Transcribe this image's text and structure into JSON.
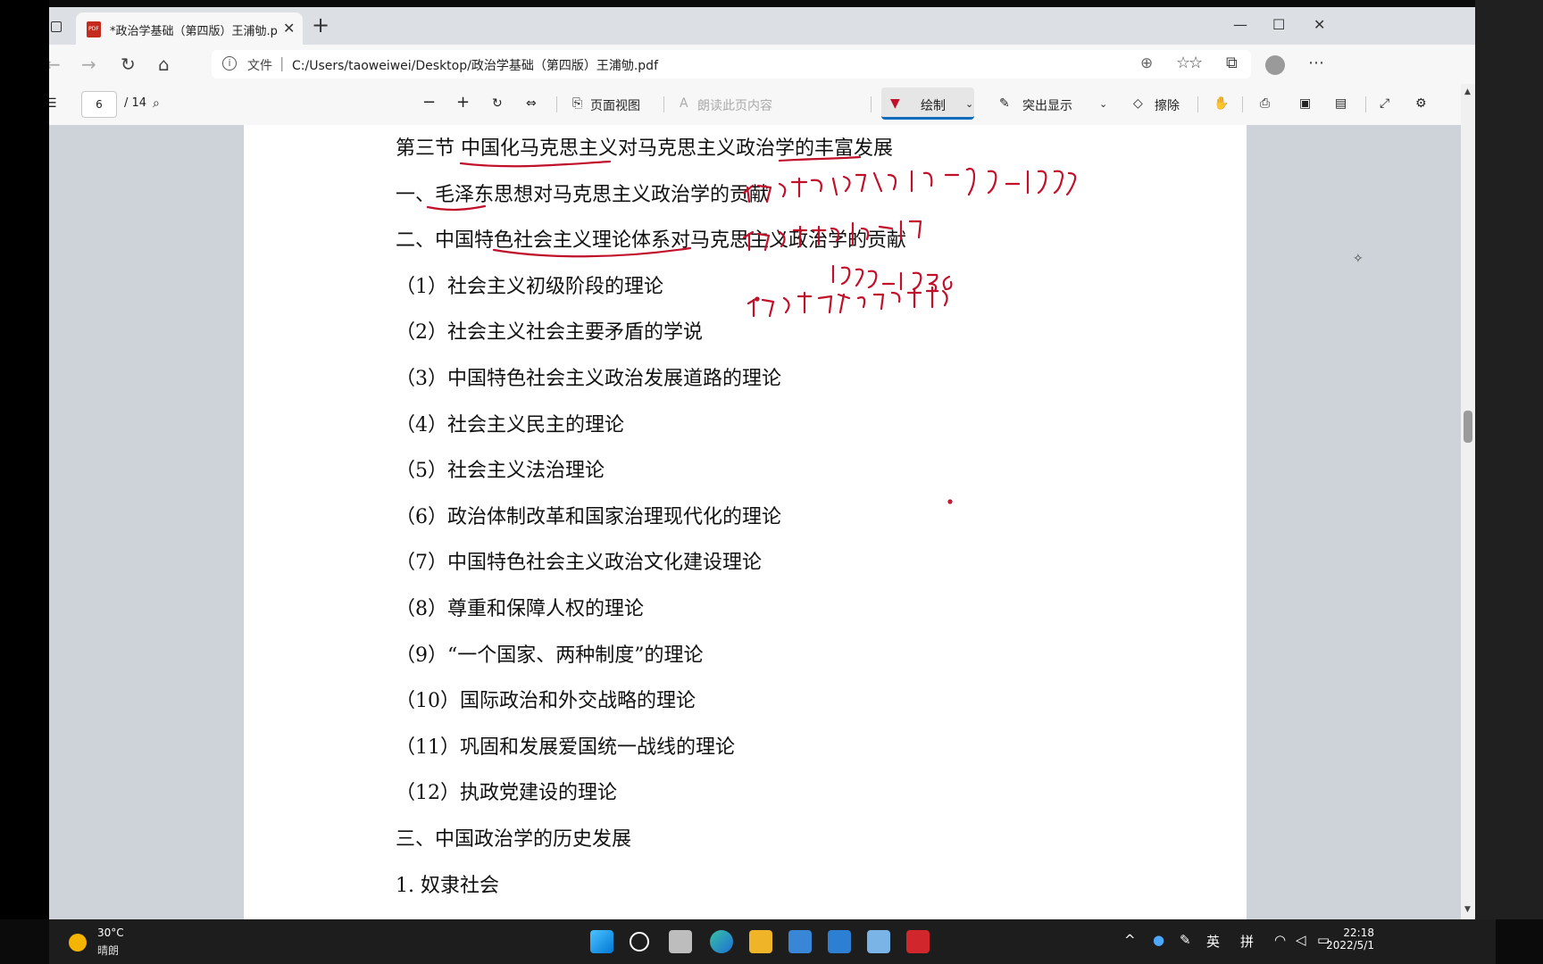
{
  "tab": {
    "title": "*政治学基础（第四版）王浦劬.p",
    "close": "✕",
    "new": "+"
  },
  "window_controls": {
    "minimize": "—",
    "maximize": "☐",
    "close": "✕"
  },
  "address": {
    "scheme": "文件",
    "url": "C:/Users/taoweiwei/Desktop/政治学基础（第四版）王浦劬.pdf"
  },
  "pdf_toolbar": {
    "page_current": "6",
    "page_total": "/ 14",
    "page_view": "页面视图",
    "read_aloud": "朗读此页内容",
    "draw": "绘制",
    "highlight": "突出显示",
    "erase": "擦除"
  },
  "document": {
    "heading": "第三节  中国化马克思主义对马克思主义政治学的丰富发展",
    "lines": [
      "一、毛泽东思想对马克思主义政治学的贡献",
      "二、中国特色社会主义理论体系对马克思主义政治学的贡献",
      "（1）社会主义初级阶段的理论",
      "（2）社会主义社会主要矛盾的学说",
      "（3）中国特色社会主义政治发展道路的理论",
      "（4）社会主义民主的理论",
      "（5）社会主义法治理论",
      "（6）政治体制改革和国家治理现代化的理论",
      "（7）中国特色社会主义政治文化建设理论",
      "（8）尊重和保障人权的理论",
      "（9）“一个国家、两种制度”的理论",
      "（10）国际政治和外交战略的理论",
      "（11）巩固和发展爱国统一战线的理论",
      "（12）执政党建设的理论",
      "三、中国政治学的历史发展",
      "1. 奴隶社会"
    ]
  },
  "taskbar": {
    "temperature": "30°C",
    "weather": "晴朗",
    "ime_lang": "英",
    "ime_mode": "拼",
    "time": "22:18",
    "date": "2022/5/1"
  },
  "colors": {
    "ink": "#c0102a",
    "accent": "#0f6cbd"
  }
}
